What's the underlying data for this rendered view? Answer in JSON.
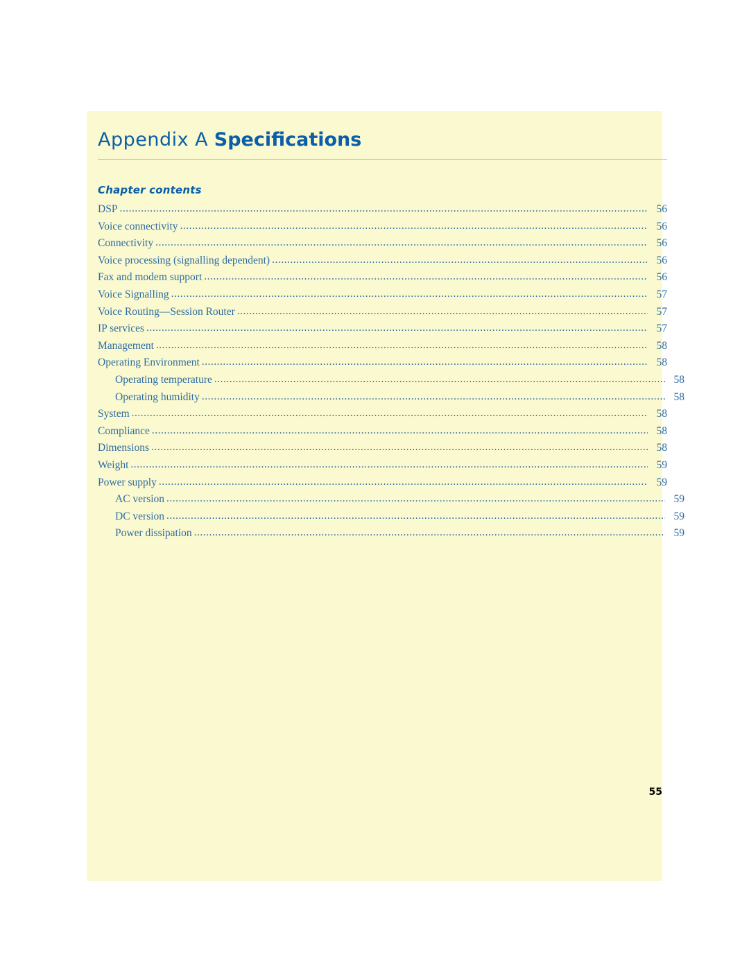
{
  "document": {
    "appendix_label": "Appendix A",
    "appendix_name": "Specifications",
    "contents_heading": "Chapter contents",
    "page_number": "55",
    "accent_color": "#0a5fa8",
    "link_color": "#2e6da4",
    "page_background": "#fbf9cf"
  },
  "toc": [
    {
      "label": "DSP",
      "page": "56",
      "level": 1
    },
    {
      "label": "Voice connectivity",
      "page": "56",
      "level": 1
    },
    {
      "label": "Connectivity",
      "page": "56",
      "level": 1
    },
    {
      "label": "Voice processing (signalling dependent)",
      "page": "56",
      "level": 1
    },
    {
      "label": "Fax and modem support",
      "page": "56",
      "level": 1
    },
    {
      "label": "Voice Signalling",
      "page": "57",
      "level": 1
    },
    {
      "label": "Voice Routing—Session Router",
      "page": "57",
      "level": 1
    },
    {
      "label": "IP services",
      "page": "57",
      "level": 1
    },
    {
      "label": "Management",
      "page": "58",
      "level": 1
    },
    {
      "label": "Operating Environment",
      "page": "58",
      "level": 1
    },
    {
      "label": "Operating temperature",
      "page": "58",
      "level": 2
    },
    {
      "label": "Operating humidity",
      "page": "58",
      "level": 2
    },
    {
      "label": "System",
      "page": "58",
      "level": 1
    },
    {
      "label": "Compliance",
      "page": "58",
      "level": 1
    },
    {
      "label": "Dimensions",
      "page": "58",
      "level": 1
    },
    {
      "label": "Weight",
      "page": "59",
      "level": 1
    },
    {
      "label": "Power supply",
      "page": "59",
      "level": 1
    },
    {
      "label": "AC version",
      "page": "59",
      "level": 2
    },
    {
      "label": "DC version",
      "page": "59",
      "level": 2
    },
    {
      "label": "Power dissipation",
      "page": "59",
      "level": 2
    }
  ]
}
